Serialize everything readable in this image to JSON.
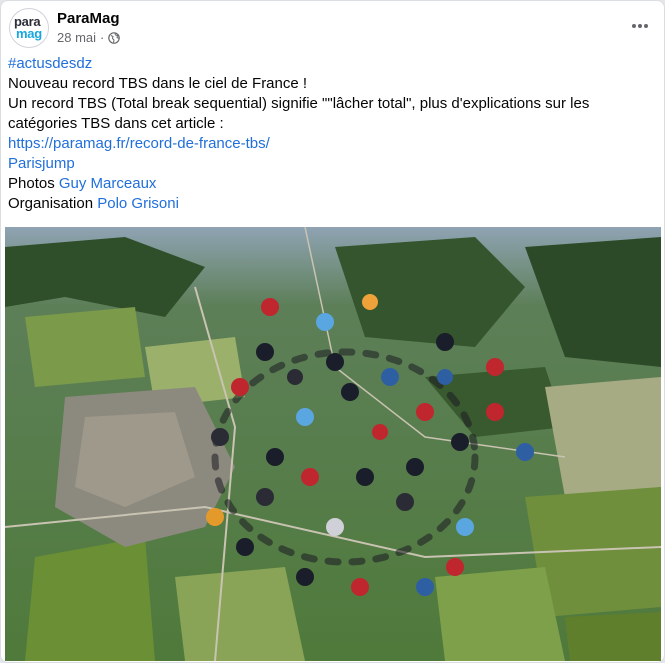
{
  "post": {
    "page_name": "ParaMag",
    "avatar": {
      "line1": "para",
      "line2": "mag"
    },
    "date": "28 mai",
    "separator": "·",
    "audience_icon": "globe-icon",
    "more_icon": "more-options-icon"
  },
  "body": {
    "hashtag": "#actusdesdz",
    "line1": "Nouveau record TBS dans le ciel de France !",
    "line2": "Un record TBS (Total break sequential) signifie \"\"lâcher total\", plus d'explications sur les catégories TBS dans cet article :",
    "url": "https://paramag.fr/record-de-france-tbs/",
    "tag": "Parisjump",
    "photos_prefix": "Photos",
    "photographer": "Guy Marceaux",
    "organisation_prefix": "Organisation",
    "organiser": "Polo Grisoni"
  },
  "colors": {
    "link": "#216fdb",
    "text": "#050505",
    "meta": "#65676b",
    "brand_blue": "#18a6df"
  }
}
